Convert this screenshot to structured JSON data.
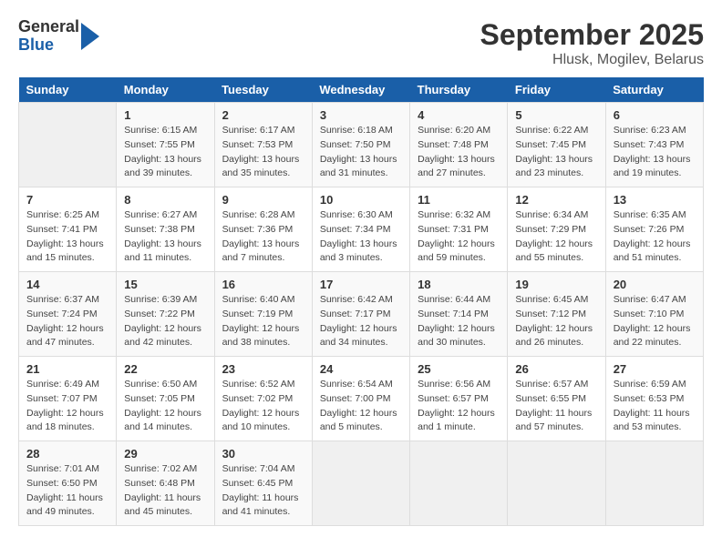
{
  "app": {
    "logo_general": "General",
    "logo_blue": "Blue"
  },
  "header": {
    "title": "September 2025",
    "subtitle": "Hlusk, Mogilev, Belarus"
  },
  "columns": [
    "Sunday",
    "Monday",
    "Tuesday",
    "Wednesday",
    "Thursday",
    "Friday",
    "Saturday"
  ],
  "weeks": [
    [
      {
        "day": "",
        "sunrise": "",
        "sunset": "",
        "daylight": ""
      },
      {
        "day": "1",
        "sunrise": "Sunrise: 6:15 AM",
        "sunset": "Sunset: 7:55 PM",
        "daylight": "Daylight: 13 hours and 39 minutes."
      },
      {
        "day": "2",
        "sunrise": "Sunrise: 6:17 AM",
        "sunset": "Sunset: 7:53 PM",
        "daylight": "Daylight: 13 hours and 35 minutes."
      },
      {
        "day": "3",
        "sunrise": "Sunrise: 6:18 AM",
        "sunset": "Sunset: 7:50 PM",
        "daylight": "Daylight: 13 hours and 31 minutes."
      },
      {
        "day": "4",
        "sunrise": "Sunrise: 6:20 AM",
        "sunset": "Sunset: 7:48 PM",
        "daylight": "Daylight: 13 hours and 27 minutes."
      },
      {
        "day": "5",
        "sunrise": "Sunrise: 6:22 AM",
        "sunset": "Sunset: 7:45 PM",
        "daylight": "Daylight: 13 hours and 23 minutes."
      },
      {
        "day": "6",
        "sunrise": "Sunrise: 6:23 AM",
        "sunset": "Sunset: 7:43 PM",
        "daylight": "Daylight: 13 hours and 19 minutes."
      }
    ],
    [
      {
        "day": "7",
        "sunrise": "Sunrise: 6:25 AM",
        "sunset": "Sunset: 7:41 PM",
        "daylight": "Daylight: 13 hours and 15 minutes."
      },
      {
        "day": "8",
        "sunrise": "Sunrise: 6:27 AM",
        "sunset": "Sunset: 7:38 PM",
        "daylight": "Daylight: 13 hours and 11 minutes."
      },
      {
        "day": "9",
        "sunrise": "Sunrise: 6:28 AM",
        "sunset": "Sunset: 7:36 PM",
        "daylight": "Daylight: 13 hours and 7 minutes."
      },
      {
        "day": "10",
        "sunrise": "Sunrise: 6:30 AM",
        "sunset": "Sunset: 7:34 PM",
        "daylight": "Daylight: 13 hours and 3 minutes."
      },
      {
        "day": "11",
        "sunrise": "Sunrise: 6:32 AM",
        "sunset": "Sunset: 7:31 PM",
        "daylight": "Daylight: 12 hours and 59 minutes."
      },
      {
        "day": "12",
        "sunrise": "Sunrise: 6:34 AM",
        "sunset": "Sunset: 7:29 PM",
        "daylight": "Daylight: 12 hours and 55 minutes."
      },
      {
        "day": "13",
        "sunrise": "Sunrise: 6:35 AM",
        "sunset": "Sunset: 7:26 PM",
        "daylight": "Daylight: 12 hours and 51 minutes."
      }
    ],
    [
      {
        "day": "14",
        "sunrise": "Sunrise: 6:37 AM",
        "sunset": "Sunset: 7:24 PM",
        "daylight": "Daylight: 12 hours and 47 minutes."
      },
      {
        "day": "15",
        "sunrise": "Sunrise: 6:39 AM",
        "sunset": "Sunset: 7:22 PM",
        "daylight": "Daylight: 12 hours and 42 minutes."
      },
      {
        "day": "16",
        "sunrise": "Sunrise: 6:40 AM",
        "sunset": "Sunset: 7:19 PM",
        "daylight": "Daylight: 12 hours and 38 minutes."
      },
      {
        "day": "17",
        "sunrise": "Sunrise: 6:42 AM",
        "sunset": "Sunset: 7:17 PM",
        "daylight": "Daylight: 12 hours and 34 minutes."
      },
      {
        "day": "18",
        "sunrise": "Sunrise: 6:44 AM",
        "sunset": "Sunset: 7:14 PM",
        "daylight": "Daylight: 12 hours and 30 minutes."
      },
      {
        "day": "19",
        "sunrise": "Sunrise: 6:45 AM",
        "sunset": "Sunset: 7:12 PM",
        "daylight": "Daylight: 12 hours and 26 minutes."
      },
      {
        "day": "20",
        "sunrise": "Sunrise: 6:47 AM",
        "sunset": "Sunset: 7:10 PM",
        "daylight": "Daylight: 12 hours and 22 minutes."
      }
    ],
    [
      {
        "day": "21",
        "sunrise": "Sunrise: 6:49 AM",
        "sunset": "Sunset: 7:07 PM",
        "daylight": "Daylight: 12 hours and 18 minutes."
      },
      {
        "day": "22",
        "sunrise": "Sunrise: 6:50 AM",
        "sunset": "Sunset: 7:05 PM",
        "daylight": "Daylight: 12 hours and 14 minutes."
      },
      {
        "day": "23",
        "sunrise": "Sunrise: 6:52 AM",
        "sunset": "Sunset: 7:02 PM",
        "daylight": "Daylight: 12 hours and 10 minutes."
      },
      {
        "day": "24",
        "sunrise": "Sunrise: 6:54 AM",
        "sunset": "Sunset: 7:00 PM",
        "daylight": "Daylight: 12 hours and 5 minutes."
      },
      {
        "day": "25",
        "sunrise": "Sunrise: 6:56 AM",
        "sunset": "Sunset: 6:57 PM",
        "daylight": "Daylight: 12 hours and 1 minute."
      },
      {
        "day": "26",
        "sunrise": "Sunrise: 6:57 AM",
        "sunset": "Sunset: 6:55 PM",
        "daylight": "Daylight: 11 hours and 57 minutes."
      },
      {
        "day": "27",
        "sunrise": "Sunrise: 6:59 AM",
        "sunset": "Sunset: 6:53 PM",
        "daylight": "Daylight: 11 hours and 53 minutes."
      }
    ],
    [
      {
        "day": "28",
        "sunrise": "Sunrise: 7:01 AM",
        "sunset": "Sunset: 6:50 PM",
        "daylight": "Daylight: 11 hours and 49 minutes."
      },
      {
        "day": "29",
        "sunrise": "Sunrise: 7:02 AM",
        "sunset": "Sunset: 6:48 PM",
        "daylight": "Daylight: 11 hours and 45 minutes."
      },
      {
        "day": "30",
        "sunrise": "Sunrise: 7:04 AM",
        "sunset": "Sunset: 6:45 PM",
        "daylight": "Daylight: 11 hours and 41 minutes."
      },
      {
        "day": "",
        "sunrise": "",
        "sunset": "",
        "daylight": ""
      },
      {
        "day": "",
        "sunrise": "",
        "sunset": "",
        "daylight": ""
      },
      {
        "day": "",
        "sunrise": "",
        "sunset": "",
        "daylight": ""
      },
      {
        "day": "",
        "sunrise": "",
        "sunset": "",
        "daylight": ""
      }
    ]
  ]
}
